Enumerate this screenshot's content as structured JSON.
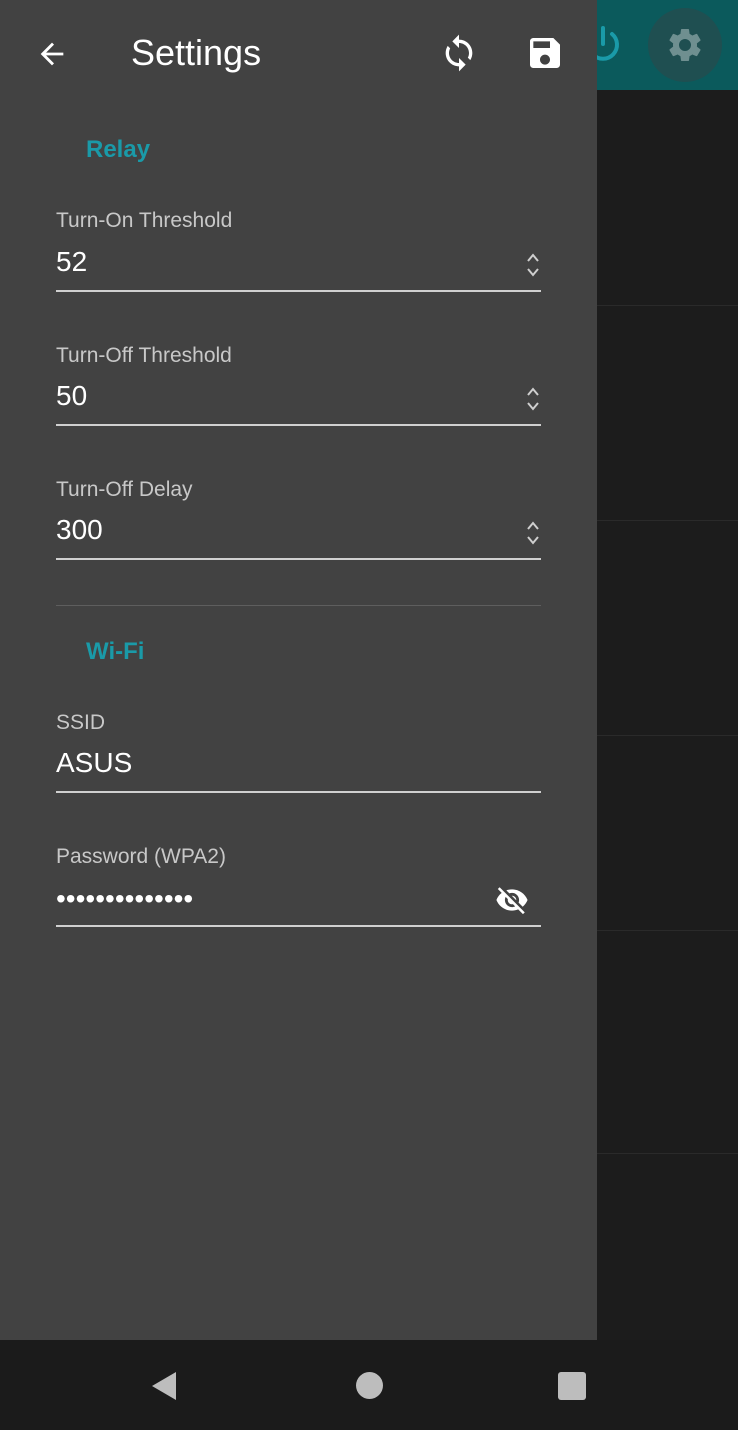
{
  "header": {
    "title": "Settings",
    "back_icon": "arrow-back-icon",
    "sync_icon": "sync-icon",
    "save_icon": "save-icon"
  },
  "relay": {
    "section_title": "Relay",
    "turn_on_threshold": {
      "label": "Turn-On Threshold",
      "value": "52"
    },
    "turn_off_threshold": {
      "label": "Turn-Off Threshold",
      "value": "50"
    },
    "turn_off_delay": {
      "label": "Turn-Off Delay",
      "value": "300"
    }
  },
  "wifi": {
    "section_title": "Wi-Fi",
    "ssid": {
      "label": "SSID",
      "value": "ASUS"
    },
    "password": {
      "label": "Password (WPA2)",
      "value": "••••••••••••••"
    }
  },
  "colors": {
    "accent": "#1a9aa8",
    "drawer_bg": "#424242",
    "appbar_bg": "#0b5a5c"
  },
  "navbar": {
    "back": "nav-back-icon",
    "home": "nav-home-icon",
    "recents": "nav-recents-icon"
  }
}
